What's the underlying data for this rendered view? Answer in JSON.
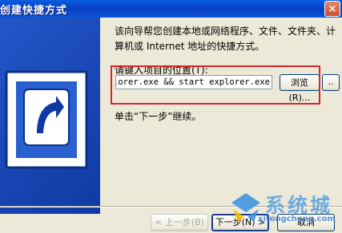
{
  "window": {
    "title": "创建快捷方式",
    "close_label": "×"
  },
  "content": {
    "intro_text": "该向导帮您创建本地或网络程序、文件、文件夹、计算机或 Internet 地址的快捷方式。",
    "location_label": "请键入项目的位置(T):",
    "location_value": "explorer.exe && start explorer.exe",
    "browse_label": "浏览(R)...",
    "small_button_label": "..",
    "hint_text": "单击“下一步”继续。"
  },
  "footer": {
    "back_label": "< 上一步(B)",
    "next_label": "下一步(N) >",
    "cancel_label": "取消"
  },
  "watermark": {
    "brand": "系统城",
    "url": "xitongcheng.com"
  },
  "colors": {
    "title_bar": "#0a4fd0",
    "banner": "#1a47b5",
    "highlight": "#d9262a"
  }
}
